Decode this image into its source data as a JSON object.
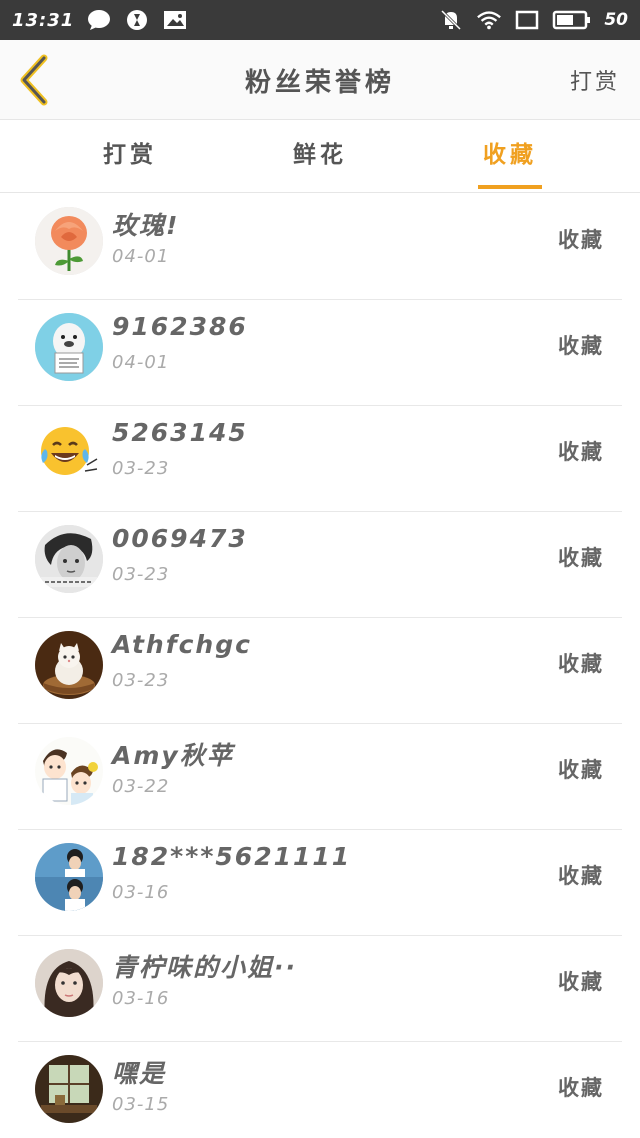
{
  "status_bar": {
    "time": "13:31",
    "battery_level": "50",
    "left_icons": [
      "chat-bubble-icon",
      "camera-shutter-icon",
      "image-notification-icon"
    ],
    "right_icons": [
      "mute-bell-icon",
      "wifi-icon",
      "window-icon",
      "battery-icon"
    ]
  },
  "header": {
    "title": "粉丝荣誉榜",
    "action_label": "打赏",
    "accent_color": "#f0a020"
  },
  "tabs": [
    {
      "label": "打赏",
      "active": false
    },
    {
      "label": "鲜花",
      "active": false
    },
    {
      "label": "收藏",
      "active": true
    }
  ],
  "list": [
    {
      "name": "玫瑰!",
      "date": "04-01",
      "action": "收藏",
      "avatar": "rose"
    },
    {
      "name": "9162386",
      "date": "04-01",
      "action": "收藏",
      "avatar": "seal"
    },
    {
      "name": "5263145",
      "date": "03-23",
      "action": "收藏",
      "avatar": "laughing-emoji"
    },
    {
      "name": "0069473",
      "date": "03-23",
      "action": "收藏",
      "avatar": "person-bw"
    },
    {
      "name": "Athfchgc",
      "date": "03-23",
      "action": "收藏",
      "avatar": "kitten"
    },
    {
      "name": "Amy秋苹",
      "date": "03-22",
      "action": "收藏",
      "avatar": "cartoon-couple"
    },
    {
      "name": "182***5621111",
      "date": "03-16",
      "action": "收藏",
      "avatar": "two-boys"
    },
    {
      "name": "青柠味的小姐··",
      "date": "03-16",
      "action": "收藏",
      "avatar": "girl"
    },
    {
      "name": "嘿是",
      "date": "03-15",
      "action": "收藏",
      "avatar": "window-scene"
    }
  ]
}
